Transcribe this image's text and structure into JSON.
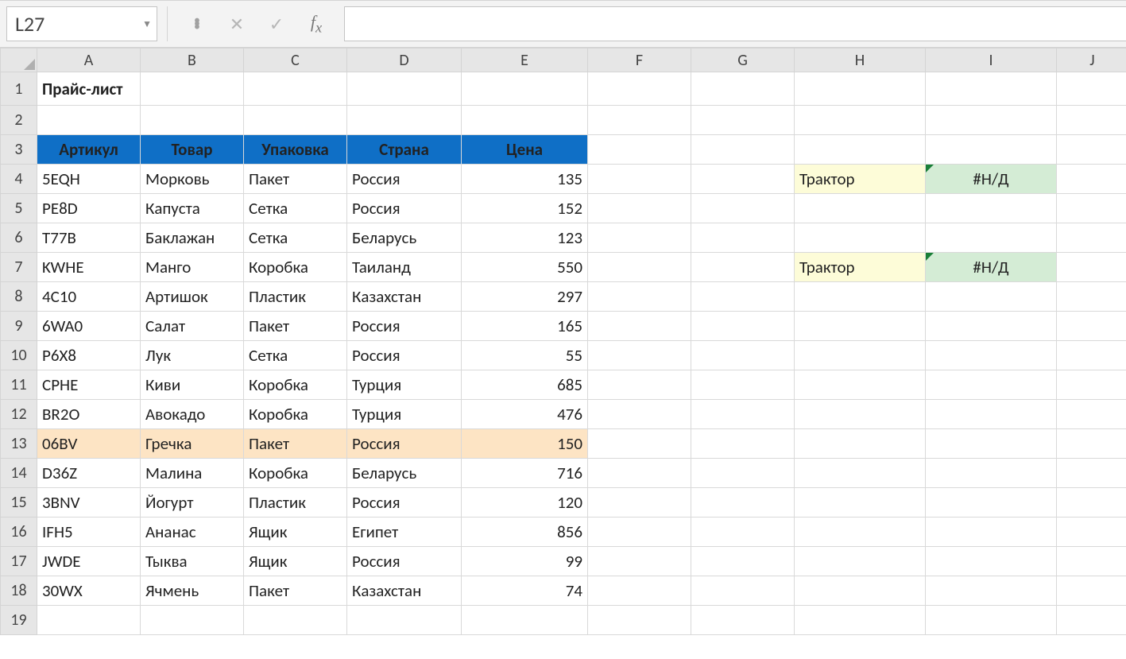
{
  "nameBox": "L27",
  "formula": "",
  "colWidths": {
    "A": 130,
    "B": 130,
    "C": 130,
    "D": 144,
    "E": 159,
    "F": 130,
    "G": 130,
    "H": 165,
    "I": 165,
    "J": 90
  },
  "columns": [
    "A",
    "B",
    "C",
    "D",
    "E",
    "F",
    "G",
    "H",
    "I",
    "J"
  ],
  "rowCount": 19,
  "title": "Прайс-лист",
  "headers": [
    "Артикул",
    "Товар",
    "Упаковка",
    "Страна",
    "Цена"
  ],
  "rows": [
    {
      "a": "5EQH",
      "b": "Морковь",
      "c": "Пакет",
      "d": "Россия",
      "e": "135"
    },
    {
      "a": "PE8D",
      "b": "Капуста",
      "c": "Сетка",
      "d": "Россия",
      "e": "152"
    },
    {
      "a": "T77B",
      "b": "Баклажан",
      "c": "Сетка",
      "d": "Беларусь",
      "e": "123"
    },
    {
      "a": "KWHE",
      "b": "Манго",
      "c": "Коробка",
      "d": "Таиланд",
      "e": "550"
    },
    {
      "a": "4C10",
      "b": "Артишок",
      "c": "Пластик",
      "d": "Казахстан",
      "e": "297"
    },
    {
      "a": "6WA0",
      "b": "Салат",
      "c": "Пакет",
      "d": "Россия",
      "e": "165"
    },
    {
      "a": "P6X8",
      "b": "Лук",
      "c": "Сетка",
      "d": "Россия",
      "e": "55"
    },
    {
      "a": "CPHE",
      "b": "Киви",
      "c": "Коробка",
      "d": "Турция",
      "e": "685"
    },
    {
      "a": "BR2O",
      "b": "Авокадо",
      "c": "Коробка",
      "d": "Турция",
      "e": "476"
    },
    {
      "a": "06BV",
      "b": "Гречка",
      "c": "Пакет",
      "d": "Россия",
      "e": "150",
      "hl": true
    },
    {
      "a": "D36Z",
      "b": "Малина",
      "c": "Коробка",
      "d": "Беларусь",
      "e": "716"
    },
    {
      "a": "3BNV",
      "b": "Йогурт",
      "c": "Пластик",
      "d": "Россия",
      "e": "120"
    },
    {
      "a": "IFH5",
      "b": "Ананас",
      "c": "Ящик",
      "d": "Египет",
      "e": "856"
    },
    {
      "a": "JWDE",
      "b": "Тыква",
      "c": "Ящик",
      "d": "Россия",
      "e": "99"
    },
    {
      "a": "30WX",
      "b": "Ячмень",
      "c": "Пакет",
      "d": "Казахстан",
      "e": "74"
    }
  ],
  "lookup": [
    {
      "row": 4,
      "h": "Трактор",
      "i": "#Н/Д"
    },
    {
      "row": 7,
      "h": "Трактор",
      "i": "#Н/Д"
    }
  ]
}
